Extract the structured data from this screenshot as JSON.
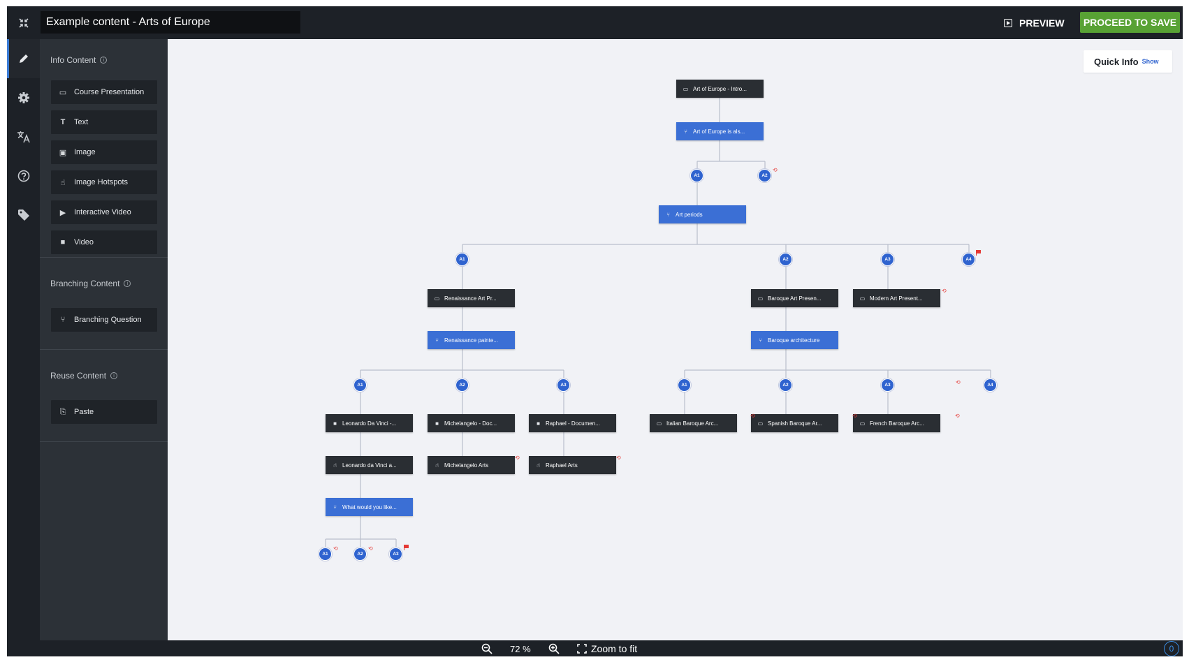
{
  "header": {
    "title_value": "Example content - Arts of Europe",
    "preview_label": "PREVIEW",
    "save_label": "PROCEED TO SAVE"
  },
  "rail": {
    "items": [
      {
        "name": "edit",
        "icon": "pencil-icon",
        "glyph": "✎"
      },
      {
        "name": "settings",
        "icon": "gear-icon",
        "glyph": "⚙"
      },
      {
        "name": "translate",
        "icon": "translate-icon",
        "glyph": "文A"
      },
      {
        "name": "help",
        "icon": "help-icon",
        "glyph": "?"
      },
      {
        "name": "tags",
        "icon": "tag-icon",
        "glyph": "🏷"
      }
    ]
  },
  "panel": {
    "info_title": "Info Content",
    "info_items": [
      {
        "label": "Course Presentation",
        "icon": "presentation-icon",
        "glyph": "▭"
      },
      {
        "label": "Text",
        "icon": "text-icon",
        "glyph": "T"
      },
      {
        "label": "Image",
        "icon": "image-icon",
        "glyph": "▣"
      },
      {
        "label": "Image Hotspots",
        "icon": "hotspot-icon",
        "glyph": "☝"
      },
      {
        "label": "Interactive Video",
        "icon": "interactive-video-icon",
        "glyph": "▶"
      },
      {
        "label": "Video",
        "icon": "video-icon",
        "glyph": "■"
      }
    ],
    "branching_title": "Branching Content",
    "branching_items": [
      {
        "label": "Branching Question",
        "icon": "branching-icon",
        "glyph": "⑂"
      }
    ],
    "reuse_title": "Reuse Content",
    "reuse_items": [
      {
        "label": "Paste",
        "icon": "paste-icon",
        "glyph": "⎘"
      }
    ]
  },
  "canvas": {
    "quick_info_label": "Quick Info",
    "quick_info_show": "Show",
    "nodes": [
      {
        "id": "n1",
        "label": "Art of Europe - Intro...",
        "kind": "dark",
        "icon": "presentation-icon"
      },
      {
        "id": "n2",
        "label": "Art of Europe is als...",
        "kind": "blue",
        "icon": "branching-icon"
      },
      {
        "id": "n3",
        "label": "Art periods",
        "kind": "blue",
        "icon": "branching-icon"
      },
      {
        "id": "n4",
        "label": "Renaissance Art Pr...",
        "kind": "dark",
        "icon": "presentation-icon"
      },
      {
        "id": "n5",
        "label": "Renaissance painte...",
        "kind": "blue",
        "icon": "branching-icon"
      },
      {
        "id": "n6",
        "label": "Baroque Art Presen...",
        "kind": "dark",
        "icon": "presentation-icon"
      },
      {
        "id": "n7",
        "label": "Baroque architecture",
        "kind": "blue",
        "icon": "branching-icon"
      },
      {
        "id": "n8",
        "label": "Modern Art Present...",
        "kind": "dark",
        "icon": "presentation-icon"
      },
      {
        "id": "n9",
        "label": "Leonardo Da Vinci -...",
        "kind": "dark",
        "icon": "video-icon"
      },
      {
        "id": "n10",
        "label": "Leonardo da Vinci a...",
        "kind": "dark",
        "icon": "hotspot-icon"
      },
      {
        "id": "n11",
        "label": "What would you like...",
        "kind": "blue",
        "icon": "branching-icon"
      },
      {
        "id": "n12",
        "label": "Michelangelo - Doc...",
        "kind": "dark",
        "icon": "video-icon"
      },
      {
        "id": "n13",
        "label": "Michelangelo Arts",
        "kind": "dark",
        "icon": "hotspot-icon"
      },
      {
        "id": "n14",
        "label": "Raphael - Documen...",
        "kind": "dark",
        "icon": "video-icon"
      },
      {
        "id": "n15",
        "label": "Raphael Arts",
        "kind": "dark",
        "icon": "hotspot-icon"
      },
      {
        "id": "n16",
        "label": "Italian Baroque Arc...",
        "kind": "dark",
        "icon": "presentation-icon"
      },
      {
        "id": "n17",
        "label": "Spanish Baroque Ar...",
        "kind": "dark",
        "icon": "presentation-icon"
      },
      {
        "id": "n18",
        "label": "French Baroque Arc...",
        "kind": "dark",
        "icon": "presentation-icon"
      }
    ],
    "answers": [
      {
        "id": "a_q1_1",
        "label": "A1"
      },
      {
        "id": "a_q1_2",
        "label": "A2"
      },
      {
        "id": "a_q2_1",
        "label": "A1"
      },
      {
        "id": "a_q2_2",
        "label": "A2"
      },
      {
        "id": "a_q2_3",
        "label": "A3"
      },
      {
        "id": "a_q2_4",
        "label": "A4"
      },
      {
        "id": "a_q3_1",
        "label": "A1"
      },
      {
        "id": "a_q3_2",
        "label": "A2"
      },
      {
        "id": "a_q3_3",
        "label": "A3"
      },
      {
        "id": "a_q4_1",
        "label": "A1"
      },
      {
        "id": "a_q4_2",
        "label": "A2"
      },
      {
        "id": "a_q4_3",
        "label": "A3"
      },
      {
        "id": "a_q4_4",
        "label": "A4"
      },
      {
        "id": "a_q5_1",
        "label": "A1"
      },
      {
        "id": "a_q5_2",
        "label": "A2"
      },
      {
        "id": "a_q5_3",
        "label": "A3"
      }
    ]
  },
  "footer": {
    "zoom_level": "72 %",
    "zoom_fit_label": "Zoom to fit",
    "notification_count": "0"
  },
  "colors": {
    "accent_blue": "#3b6fd5",
    "save_green": "#58a234",
    "loop_red": "#e53935"
  }
}
